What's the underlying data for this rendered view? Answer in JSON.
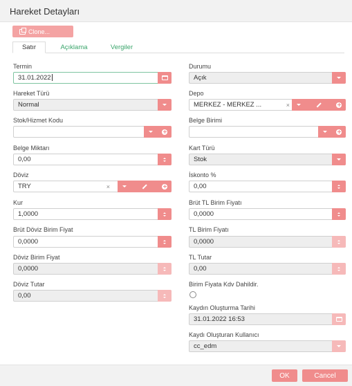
{
  "dialog": {
    "title": "Hareket Detayları"
  },
  "toolbar": {
    "clone_label": "Clone..."
  },
  "tabs": [
    {
      "label": "Satır"
    },
    {
      "label": "Açıklama"
    },
    {
      "label": "Vergiler"
    }
  ],
  "left": {
    "termin": {
      "label": "Termin",
      "value": "31.01.2022"
    },
    "hareket_turu": {
      "label": "Hareket Türü",
      "value": "Normal"
    },
    "stok_kodu": {
      "label": "Stok/Hizmet Kodu",
      "value": ""
    },
    "belge_miktari": {
      "label": "Belge Miktarı",
      "value": "0,00"
    },
    "doviz": {
      "label": "Döviz",
      "value": "TRY"
    },
    "kur": {
      "label": "Kur",
      "value": "1,0000"
    },
    "brut_doviz_birim_fiyat": {
      "label": "Brüt Döviz Birim Fiyat",
      "value": "0,0000"
    },
    "doviz_birim_fiyat": {
      "label": "Döviz Birim Fiyat",
      "value": "0,0000"
    },
    "doviz_tutar": {
      "label": "Döviz Tutar",
      "value": "0,00"
    }
  },
  "right": {
    "durumu": {
      "label": "Durumu",
      "value": "Açık"
    },
    "depo": {
      "label": "Depo",
      "value": "MERKEZ - MERKEZ ..."
    },
    "belge_birimi": {
      "label": "Belge Birimi",
      "value": ""
    },
    "kart_turu": {
      "label": "Kart Türü",
      "value": "Stok"
    },
    "iskonto": {
      "label": "İskonto %",
      "value": "0,00"
    },
    "brut_tl_birim_fiyati": {
      "label": "Brüt TL Birim Fiyatı",
      "value": "0,0000"
    },
    "tl_birim_fiyati": {
      "label": "TL Birim Fiyatı",
      "value": "0,0000"
    },
    "tl_tutar": {
      "label": "TL Tutar",
      "value": "0,00"
    },
    "kdv_dahil": {
      "label": "Birim Fiyata Kdv Dahildir.",
      "checked": false
    },
    "kayit_tarihi": {
      "label": "Kaydın Oluşturma Tarihi",
      "value": "31.01.2022 16:53"
    },
    "kaydi_olusturan": {
      "label": "Kaydı Oluşturan Kullanıcı",
      "value": "cc_edm"
    }
  },
  "footer": {
    "ok_label": "OK",
    "cancel_label": "Cancel"
  },
  "icons": {
    "clear": "×",
    "copy": "copy-icon",
    "calendar": "calendar-icon",
    "caret": "chevron-down-icon",
    "spinner": "spinner-icon",
    "edit": "pencil-icon",
    "add": "plus-circle-icon"
  },
  "colors": {
    "accent": "#f08c8c",
    "accent_light": "#f6b9b9",
    "tab_text": "#3aa56b",
    "disabled_bg": "#eeeeee"
  }
}
